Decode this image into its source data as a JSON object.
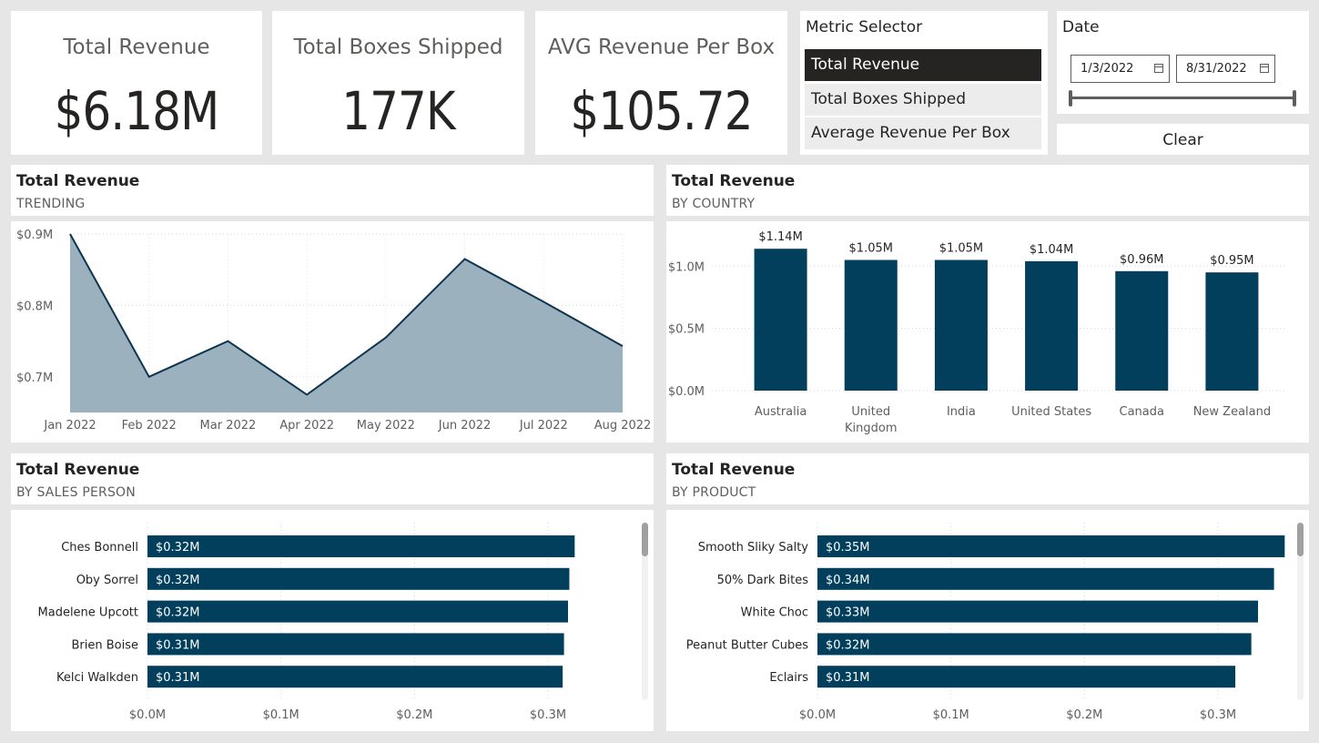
{
  "kpis": {
    "revenue": {
      "label": "Total Revenue",
      "value": "$6.18M"
    },
    "boxes": {
      "label": "Total Boxes Shipped",
      "value": "177K"
    },
    "avg": {
      "label": "AVG Revenue Per Box",
      "value": "$105.72"
    }
  },
  "metric_selector": {
    "title": "Metric Selector",
    "options": [
      "Total Revenue",
      "Total Boxes Shipped",
      "Average Revenue Per Box"
    ],
    "selected": "Total Revenue"
  },
  "date_slicer": {
    "title": "Date",
    "start": "1/3/2022",
    "end": "8/31/2022",
    "range_fraction": [
      0,
      1
    ]
  },
  "clear_button": {
    "label": "Clear"
  },
  "colors": {
    "bar": "#013f5c",
    "area_fill": "#9bb2be",
    "line": "#0d3550",
    "selected": "#252423"
  },
  "panels": {
    "trending": {
      "title": "Total Revenue",
      "subtitle": "TRENDING"
    },
    "country": {
      "title": "Total Revenue",
      "subtitle": "BY COUNTRY"
    },
    "salesperson": {
      "title": "Total Revenue",
      "subtitle": "BY SALES PERSON"
    },
    "product": {
      "title": "Total Revenue",
      "subtitle": "BY PRODUCT"
    }
  },
  "chart_data": [
    {
      "id": "trending",
      "type": "area",
      "x": [
        "Jan 2022",
        "Feb 2022",
        "Mar 2022",
        "Apr 2022",
        "May 2022",
        "Jun 2022",
        "Jul 2022",
        "Aug 2022"
      ],
      "values": [
        0.9,
        0.7,
        0.75,
        0.675,
        0.755,
        0.865,
        0.805,
        0.743
      ],
      "yticks": [
        "$0.7M",
        "$0.8M",
        "$0.9M"
      ],
      "ytick_values": [
        0.7,
        0.8,
        0.9
      ],
      "ylim": [
        0.65,
        0.9
      ],
      "grid": true
    },
    {
      "id": "country",
      "type": "bar",
      "categories": [
        "Australia",
        "United Kingdom",
        "India",
        "United States",
        "Canada",
        "New Zealand"
      ],
      "category_lines": [
        [
          "Australia"
        ],
        [
          "United",
          "Kingdom"
        ],
        [
          "India"
        ],
        [
          "United States"
        ],
        [
          "Canada"
        ],
        [
          "New Zealand"
        ]
      ],
      "values": [
        1.14,
        1.05,
        1.05,
        1.04,
        0.96,
        0.95
      ],
      "labels": [
        "$1.14M",
        "$1.05M",
        "$1.05M",
        "$1.04M",
        "$0.96M",
        "$0.95M"
      ],
      "yticks": [
        "$0.0M",
        "$0.5M",
        "$1.0M"
      ],
      "ytick_values": [
        0,
        0.5,
        1.0
      ],
      "ylim": [
        0,
        1.2
      ]
    },
    {
      "id": "salesperson",
      "type": "bar",
      "orientation": "horizontal",
      "categories": [
        "Ches Bonnell",
        "Oby Sorrel",
        "Madelene Upcott",
        "Brien Boise",
        "Kelci Walkden"
      ],
      "values": [
        0.32,
        0.316,
        0.315,
        0.312,
        0.311
      ],
      "labels": [
        "$0.32M",
        "$0.32M",
        "$0.32M",
        "$0.31M",
        "$0.31M"
      ],
      "xticks": [
        "$0.0M",
        "$0.1M",
        "$0.2M",
        "$0.3M"
      ],
      "xtick_values": [
        0,
        0.1,
        0.2,
        0.3
      ],
      "xlim": [
        0,
        0.32
      ]
    },
    {
      "id": "product",
      "type": "bar",
      "orientation": "horizontal",
      "categories": [
        "Smooth Sliky Salty",
        "50% Dark Bites",
        "White Choc",
        "Peanut Butter Cubes",
        "Eclairs"
      ],
      "values": [
        0.35,
        0.342,
        0.33,
        0.325,
        0.313
      ],
      "labels": [
        "$0.35M",
        "$0.34M",
        "$0.33M",
        "$0.32M",
        "$0.31M"
      ],
      "xticks": [
        "$0.0M",
        "$0.1M",
        "$0.2M",
        "$0.3M"
      ],
      "xtick_values": [
        0,
        0.1,
        0.2,
        0.3
      ],
      "xlim": [
        0,
        0.35
      ]
    }
  ]
}
